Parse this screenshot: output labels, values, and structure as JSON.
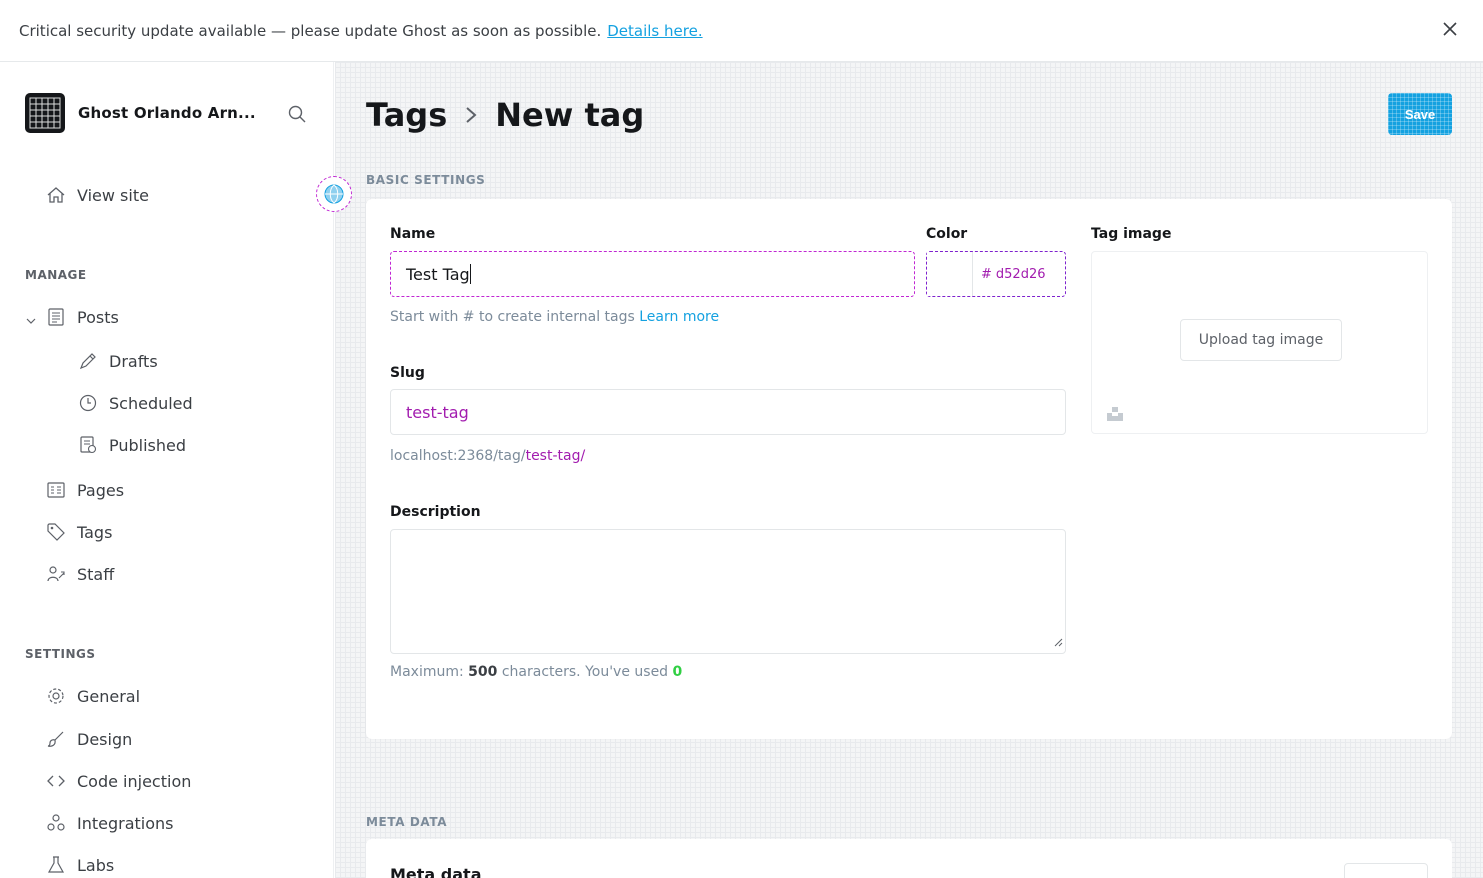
{
  "alert": {
    "message": "Critical security update available — please update Ghost as soon as possible.",
    "link": "Details here."
  },
  "sidebar": {
    "site_title": "Ghost Orlando Arn...",
    "view_site": "View site",
    "manage_label": "MANAGE",
    "settings_label": "SETTINGS",
    "items": {
      "posts": "Posts",
      "drafts": "Drafts",
      "scheduled": "Scheduled",
      "published": "Published",
      "pages": "Pages",
      "tags": "Tags",
      "staff": "Staff",
      "general": "General",
      "design": "Design",
      "code_injection": "Code injection",
      "integrations": "Integrations",
      "labs": "Labs"
    }
  },
  "header": {
    "crumb_parent": "Tags",
    "crumb_current": "New tag",
    "save_label": "Save"
  },
  "basic": {
    "group_title": "BASIC SETTINGS",
    "name_label": "Name",
    "name_value": "Test Tag",
    "name_hint_prefix": "Start with # to create internal tags",
    "name_hint_link": "Learn more",
    "color_label": "Color",
    "color_hash": "#",
    "color_value": "d52d26",
    "image_label": "Tag image",
    "upload_label": "Upload tag image",
    "slug_label": "Slug",
    "slug_value": "test-tag",
    "url_prefix": "localhost:2368/tag/",
    "url_slug": "test-tag/",
    "description_label": "Description",
    "desc_hint_prefix": "Maximum:",
    "desc_max": "500",
    "desc_hint_mid": "characters. You've used",
    "desc_used": "0"
  },
  "meta": {
    "group_title": "META DATA",
    "card_title": "Meta data"
  },
  "colors": {
    "accent": "#14a1e0",
    "focus": "#c026d3",
    "text": "#15171a"
  }
}
